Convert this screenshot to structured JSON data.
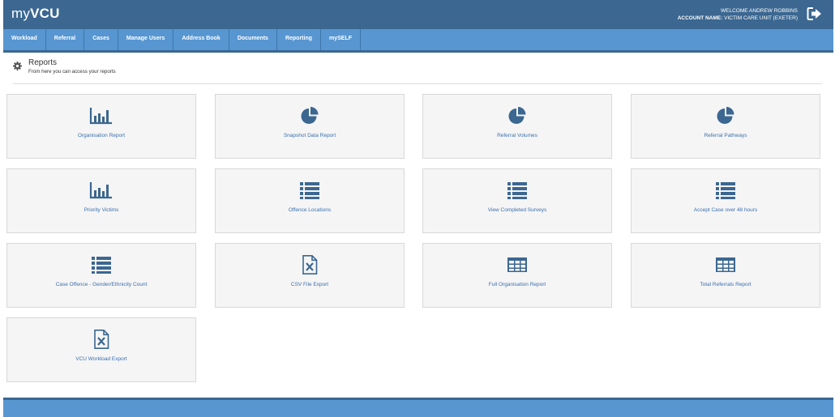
{
  "app": {
    "logo_prefix": "my",
    "logo_suffix": "VCU"
  },
  "user": {
    "welcome": "WELCOME ANDREW ROBBINS",
    "account_label": "ACCOUNT NAME:",
    "account_name": "VICTIM CARE UNIT (EXETER)"
  },
  "nav": {
    "items": [
      {
        "label": "Workload"
      },
      {
        "label": "Referral"
      },
      {
        "label": "Cases"
      },
      {
        "label": "Manage Users"
      },
      {
        "label": "Address Book"
      },
      {
        "label": "Documents"
      },
      {
        "label": "Reporting"
      },
      {
        "label": "mySELF"
      }
    ]
  },
  "page": {
    "title": "Reports",
    "subtitle": "From here you can access your reports"
  },
  "reports": [
    {
      "label": "Organisation Report",
      "icon": "bar-chart-icon"
    },
    {
      "label": "Snapshot Data Report",
      "icon": "pie-chart-icon"
    },
    {
      "label": "Referral Volumes",
      "icon": "pie-chart-icon"
    },
    {
      "label": "Referral Pathways",
      "icon": "pie-chart-icon"
    },
    {
      "label": "Priority Victims",
      "icon": "bar-chart-icon"
    },
    {
      "label": "Offence Locations",
      "icon": "list-icon"
    },
    {
      "label": "View Completed Surveys",
      "icon": "list-icon"
    },
    {
      "label": "Accept Case over 48 hours",
      "icon": "list-icon"
    },
    {
      "label": "Case Offence - Gender/Ethnicity Count",
      "icon": "list-icon"
    },
    {
      "label": "CSV File Export",
      "icon": "excel-file-icon"
    },
    {
      "label": "Full Organisation Report",
      "icon": "table-icon"
    },
    {
      "label": "Total Referrals Report",
      "icon": "table-icon"
    },
    {
      "label": "VCU Workload Export",
      "icon": "excel-file-icon"
    }
  ],
  "colors": {
    "header": "#3b6791",
    "nav": "#5796d1",
    "link": "#3b6fae",
    "icon": "#3b6791"
  }
}
